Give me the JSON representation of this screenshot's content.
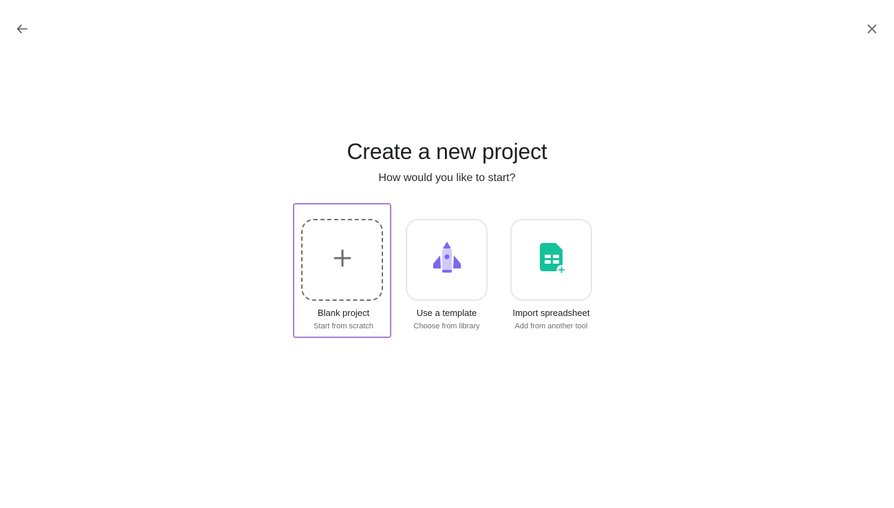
{
  "header": {
    "back_icon": "arrow-left-icon",
    "close_icon": "close-icon"
  },
  "title": "Create a new project",
  "subtitle": "How would you like to start?",
  "options": [
    {
      "label": "Blank project",
      "sub": "Start from scratch",
      "icon": "plus-icon",
      "selected": true
    },
    {
      "label": "Use a template",
      "sub": "Choose from library",
      "icon": "rocket-icon",
      "selected": false
    },
    {
      "label": "Import spreadsheet",
      "sub": "Add from another tool",
      "icon": "spreadsheet-import-icon",
      "selected": false
    }
  ],
  "colors": {
    "selected_border": "#a47ed6",
    "rocket_purple": "#7b68ee",
    "sheet_green": "#13c29a"
  }
}
